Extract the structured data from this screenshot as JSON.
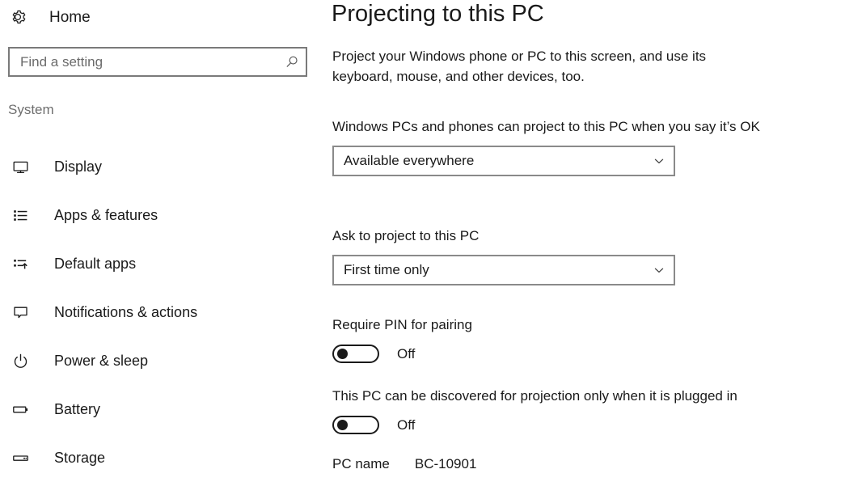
{
  "sidebar": {
    "home": {
      "label": "Home",
      "icon": "gear-icon"
    },
    "search": {
      "placeholder": "Find a setting",
      "value": "",
      "icon": "search-icon"
    },
    "section_header": "System",
    "items": [
      {
        "label": "Display",
        "icon": "monitor-icon"
      },
      {
        "label": "Apps & features",
        "icon": "list-bullet-icon"
      },
      {
        "label": "Default apps",
        "icon": "list-arrow-icon"
      },
      {
        "label": "Notifications & actions",
        "icon": "speech-bubble-icon"
      },
      {
        "label": "Power & sleep",
        "icon": "power-icon"
      },
      {
        "label": "Battery",
        "icon": "battery-icon"
      },
      {
        "label": "Storage",
        "icon": "hard-drive-icon"
      }
    ]
  },
  "main": {
    "title": "Projecting to this PC",
    "description": "Project your Windows phone or PC to this screen, and use its keyboard, mouse, and other devices, too.",
    "settings": {
      "project_permission": {
        "label": "Windows PCs and phones can project to this PC when you say it’s OK",
        "value": "Available everywhere",
        "arrow_icon": "chevron-down-icon"
      },
      "ask_to_project": {
        "label": "Ask to project to this PC",
        "value": "First time only",
        "arrow_icon": "chevron-down-icon"
      },
      "require_pin": {
        "label": "Require PIN for pairing",
        "state": "Off",
        "on": false
      },
      "plugged_in_only": {
        "label": "This PC can be discovered for projection only when it is plugged in",
        "state": "Off",
        "on": false
      },
      "pc_name": {
        "label": "PC name",
        "value": "BC-10901"
      }
    }
  },
  "colors": {
    "text_primary": "#1a1a1a",
    "text_secondary": "#6e6e6e",
    "border": "#8a8a8a",
    "search_border": "#7a7a7a",
    "background": "#ffffff",
    "accent": "#0078d7"
  }
}
